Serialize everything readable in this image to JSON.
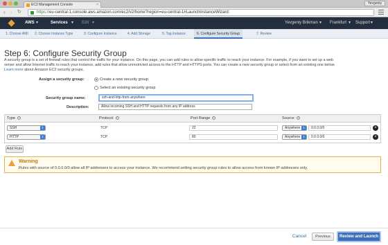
{
  "browser": {
    "tab_title": "EC2 Management Console",
    "profile": "Yevgeniy",
    "url_secure": "https://",
    "url_rest": "eu-central-1.console.aws.amazon.com/ec2/v2/home?region=eu-central-1#LaunchInstanceWizard:"
  },
  "aws_nav": {
    "aws_label": "AWS",
    "services_label": "Services",
    "edit_label": "Edit",
    "user": "Yevgeniy Brikman",
    "region": "Frankfurt",
    "support": "Support"
  },
  "steps": [
    {
      "label": "1. Choose AMI",
      "active": false
    },
    {
      "label": "2. Choose Instance Type",
      "active": false
    },
    {
      "label": "3. Configure Instance",
      "active": false
    },
    {
      "label": "4. Add Storage",
      "active": false
    },
    {
      "label": "5. Tag Instance",
      "active": false
    },
    {
      "label": "6. Configure Security Group",
      "active": true
    },
    {
      "label": "7. Review",
      "active": false
    }
  ],
  "page": {
    "title": "Step 6: Configure Security Group",
    "desc_line1": "A security group is a set of firewall rules that control the traffic for your instance. On this page, you can add rules to allow specific traffic to reach your instance. For example, if you want to set up a web",
    "desc_line2": "server and allow Internet traffic to reach your instance, add rules that allow unrestricted access to the HTTP and HTTPS ports. You can create a new security group or select from an existing one below.",
    "learn_more": "Learn more",
    "learn_more_suffix": " about Amazon EC2 security groups."
  },
  "form": {
    "assign_label": "Assign a security group:",
    "option_create": "Create a new security group",
    "option_existing": "Select an existing security group",
    "name_label": "Security group name:",
    "name_value": "ssh-and-http-from-anywhere",
    "desc_label": "Description:",
    "desc_value": "Allow incoming SSH and HTTP requests from any IP address"
  },
  "table": {
    "headers": {
      "type": "Type",
      "protocol": "Protocol",
      "port": "Port Range",
      "source": "Source"
    },
    "rows": [
      {
        "type": "SSH",
        "protocol": "TCP",
        "port": "22",
        "source_mode": "Anywhere",
        "source_cidr": "0.0.0.0/0"
      },
      {
        "type": "HTTP",
        "protocol": "TCP",
        "port": "80",
        "source_mode": "Anywhere",
        "source_cidr": "0.0.0.0/0"
      }
    ],
    "add_rule": "Add Rule"
  },
  "warning": {
    "title": "Warning",
    "text": "Rules with source of 0.0.0.0/0 allow all IP addresses to access your instance. We recommend setting security group rules to allow access from known IP addresses only."
  },
  "footer": {
    "cancel": "Cancel",
    "previous": "Previous",
    "review_launch": "Review and Launch"
  },
  "colors": {
    "aws_nav_bg": "#232f3e",
    "accent_blue": "#3c70b8",
    "warning_orange": "#e8a23b"
  }
}
